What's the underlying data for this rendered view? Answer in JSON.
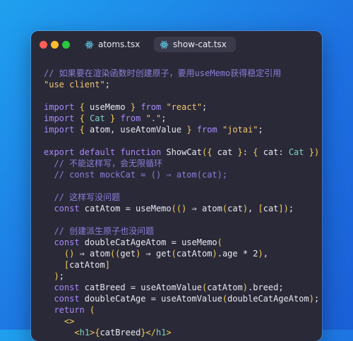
{
  "tabs": [
    {
      "label": "atoms.tsx",
      "icon": "react-icon",
      "active": false
    },
    {
      "label": "show-cat.tsx",
      "icon": "react-icon",
      "active": true
    }
  ],
  "colors": {
    "background": "#1d7fe6",
    "window": "#2a2938",
    "comment": "#8b7fd9",
    "string": "#f0c674",
    "keyword": "#a78bfa",
    "type": "#7dd3c0",
    "punct": "#f7d154",
    "ident": "#e8e8f0"
  },
  "code_lines": [
    [
      [
        "comment",
        "// 如果要在渲染函数时创建原子，要用useMemo获得稳定引用"
      ]
    ],
    [
      [
        "string",
        "\"use client\""
      ],
      [
        "ident",
        ";"
      ]
    ],
    [],
    [
      [
        "keyword",
        "import"
      ],
      [
        "ident",
        " "
      ],
      [
        "punct",
        "{"
      ],
      [
        "ident",
        " useMemo "
      ],
      [
        "punct",
        "}"
      ],
      [
        "ident",
        " "
      ],
      [
        "keyword",
        "from"
      ],
      [
        "ident",
        " "
      ],
      [
        "string",
        "\"react\""
      ],
      [
        "ident",
        ";"
      ]
    ],
    [
      [
        "keyword",
        "import"
      ],
      [
        "ident",
        " "
      ],
      [
        "punct",
        "{"
      ],
      [
        "ident",
        " "
      ],
      [
        "type",
        "Cat"
      ],
      [
        "ident",
        " "
      ],
      [
        "punct",
        "}"
      ],
      [
        "ident",
        " "
      ],
      [
        "keyword",
        "from"
      ],
      [
        "ident",
        " "
      ],
      [
        "string",
        "\".\""
      ],
      [
        "ident",
        ";"
      ]
    ],
    [
      [
        "keyword",
        "import"
      ],
      [
        "ident",
        " "
      ],
      [
        "punct",
        "{"
      ],
      [
        "ident",
        " atom, useAtomValue "
      ],
      [
        "punct",
        "}"
      ],
      [
        "ident",
        " "
      ],
      [
        "keyword",
        "from"
      ],
      [
        "ident",
        " "
      ],
      [
        "string",
        "\"jotai\""
      ],
      [
        "ident",
        ";"
      ]
    ],
    [],
    [
      [
        "keyword",
        "export default function"
      ],
      [
        "ident",
        " ShowCat"
      ],
      [
        "punct",
        "({"
      ],
      [
        "ident",
        " cat "
      ],
      [
        "punct",
        "}"
      ],
      [
        "ident",
        ": "
      ],
      [
        "punct",
        "{"
      ],
      [
        "ident",
        " cat: "
      ],
      [
        "type",
        "Cat"
      ],
      [
        "ident",
        " "
      ],
      [
        "punct",
        "})"
      ],
      [
        "ident",
        " "
      ],
      [
        "punct",
        "{"
      ]
    ],
    [
      [
        "ident",
        "  "
      ],
      [
        "comment",
        "// 不能这样写，会无限循环"
      ]
    ],
    [
      [
        "ident",
        "  "
      ],
      [
        "comment",
        "// const mockCat = () ⇒ atom(cat);"
      ]
    ],
    [],
    [
      [
        "ident",
        "  "
      ],
      [
        "comment",
        "// 这样写没问题"
      ]
    ],
    [
      [
        "ident",
        "  "
      ],
      [
        "keyword",
        "const"
      ],
      [
        "ident",
        " catAtom = useMemo"
      ],
      [
        "punct",
        "(()"
      ],
      [
        "ident",
        " ⇒ atom"
      ],
      [
        "punct",
        "("
      ],
      [
        "ident",
        "cat"
      ],
      [
        "punct",
        ")"
      ],
      [
        "ident",
        ", "
      ],
      [
        "punct",
        "["
      ],
      [
        "ident",
        "cat"
      ],
      [
        "punct",
        "])"
      ],
      [
        "ident",
        ";"
      ]
    ],
    [],
    [
      [
        "ident",
        "  "
      ],
      [
        "comment",
        "// 创建派生原子也没问题"
      ]
    ],
    [
      [
        "ident",
        "  "
      ],
      [
        "keyword",
        "const"
      ],
      [
        "ident",
        " doubleCatAgeAtom = useMemo"
      ],
      [
        "punct",
        "("
      ]
    ],
    [
      [
        "ident",
        "    "
      ],
      [
        "punct",
        "()"
      ],
      [
        "ident",
        " ⇒ atom"
      ],
      [
        "punct",
        "(("
      ],
      [
        "ident",
        "get"
      ],
      [
        "punct",
        ")"
      ],
      [
        "ident",
        " ⇒ get"
      ],
      [
        "punct",
        "("
      ],
      [
        "ident",
        "catAtom"
      ],
      [
        "punct",
        ")"
      ],
      [
        "ident",
        ".age * 2"
      ],
      [
        "punct",
        ")"
      ],
      [
        "ident",
        ","
      ]
    ],
    [
      [
        "ident",
        "    "
      ],
      [
        "punct",
        "["
      ],
      [
        "ident",
        "catAtom"
      ],
      [
        "punct",
        "]"
      ]
    ],
    [
      [
        "ident",
        "  "
      ],
      [
        "punct",
        ")"
      ],
      [
        "ident",
        ";"
      ]
    ],
    [
      [
        "ident",
        "  "
      ],
      [
        "keyword",
        "const"
      ],
      [
        "ident",
        " catBreed = useAtomValue"
      ],
      [
        "punct",
        "("
      ],
      [
        "ident",
        "catAtom"
      ],
      [
        "punct",
        ")"
      ],
      [
        "ident",
        ".breed;"
      ]
    ],
    [
      [
        "ident",
        "  "
      ],
      [
        "keyword",
        "const"
      ],
      [
        "ident",
        " doubleCatAge = useAtomValue"
      ],
      [
        "punct",
        "("
      ],
      [
        "ident",
        "doubleCatAgeAtom"
      ],
      [
        "punct",
        ")"
      ],
      [
        "ident",
        ";"
      ]
    ],
    [
      [
        "ident",
        "  "
      ],
      [
        "keyword",
        "return"
      ],
      [
        "ident",
        " "
      ],
      [
        "punct",
        "("
      ]
    ],
    [
      [
        "ident",
        "    "
      ],
      [
        "punct",
        "<>"
      ]
    ],
    [
      [
        "ident",
        "      "
      ],
      [
        "punct",
        "<"
      ],
      [
        "type",
        "h1"
      ],
      [
        "punct",
        ">"
      ],
      [
        "punct",
        "{"
      ],
      [
        "ident",
        "catBreed"
      ],
      [
        "punct",
        "}"
      ],
      [
        "punct",
        "</"
      ],
      [
        "type",
        "h1"
      ],
      [
        "punct",
        ">"
      ]
    ]
  ]
}
